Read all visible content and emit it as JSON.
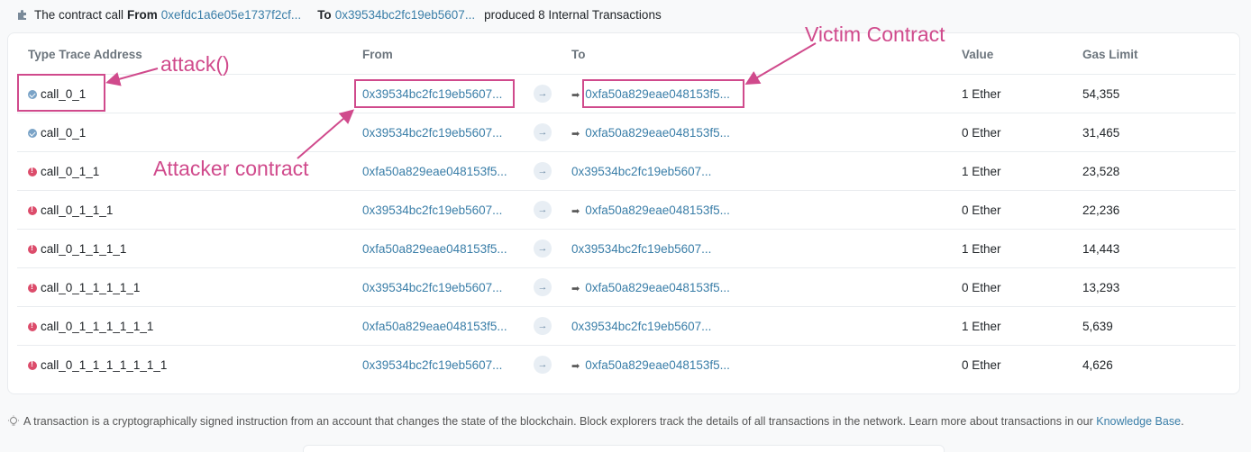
{
  "summary": {
    "prefix": "The contract call",
    "from_label": "From",
    "from_address": "0xefdc1a6e05e1737f2cf...",
    "to_label": "To",
    "to_address": "0x39534bc2fc19eb5607...",
    "suffix": "produced 8 Internal Transactions"
  },
  "table": {
    "headers": [
      "Type Trace Address",
      "From",
      "To",
      "Value",
      "Gas Limit"
    ],
    "rows": [
      {
        "status": "success",
        "type": "call_0_1",
        "from": "0x39534bc2fc19eb5607...",
        "to": "0xfa50a829eae048153f5...",
        "to_is_contract": true,
        "value": "1 Ether",
        "gas": "54,355"
      },
      {
        "status": "success",
        "type": "call_0_1",
        "from": "0x39534bc2fc19eb5607...",
        "to": "0xfa50a829eae048153f5...",
        "to_is_contract": true,
        "value": "0 Ether",
        "gas": "31,465"
      },
      {
        "status": "error",
        "type": "call_0_1_1",
        "from": "0xfa50a829eae048153f5...",
        "to": "0x39534bc2fc19eb5607...",
        "to_is_contract": false,
        "value": "1 Ether",
        "gas": "23,528"
      },
      {
        "status": "error",
        "type": "call_0_1_1_1",
        "from": "0x39534bc2fc19eb5607...",
        "to": "0xfa50a829eae048153f5...",
        "to_is_contract": true,
        "value": "0 Ether",
        "gas": "22,236"
      },
      {
        "status": "error",
        "type": "call_0_1_1_1_1",
        "from": "0xfa50a829eae048153f5...",
        "to": "0x39534bc2fc19eb5607...",
        "to_is_contract": false,
        "value": "1 Ether",
        "gas": "14,443"
      },
      {
        "status": "error",
        "type": "call_0_1_1_1_1_1",
        "from": "0x39534bc2fc19eb5607...",
        "to": "0xfa50a829eae048153f5...",
        "to_is_contract": true,
        "value": "0 Ether",
        "gas": "13,293"
      },
      {
        "status": "error",
        "type": "call_0_1_1_1_1_1_1",
        "from": "0xfa50a829eae048153f5...",
        "to": "0x39534bc2fc19eb5607...",
        "to_is_contract": false,
        "value": "1 Ether",
        "gas": "5,639"
      },
      {
        "status": "error",
        "type": "call_0_1_1_1_1_1_1_1",
        "from": "0x39534bc2fc19eb5607...",
        "to": "0xfa50a829eae048153f5...",
        "to_is_contract": true,
        "value": "0 Ether",
        "gas": "4,626"
      }
    ]
  },
  "annotations": {
    "attack": "attack()",
    "attacker": "Attacker contract",
    "victim": "Victim Contract",
    "color": "#d04a8c"
  },
  "footer": {
    "text": "A transaction is a cryptographically signed instruction from an account that changes the state of the blockchain. Block explorers track the details of all transactions in the network. Learn more about transactions in our",
    "link": "Knowledge Base",
    "end": "."
  },
  "colors": {
    "link": "#3a7ea8",
    "success": "#7aa3c7",
    "error": "#dc4c6b",
    "highlight": "#d04a8c"
  }
}
